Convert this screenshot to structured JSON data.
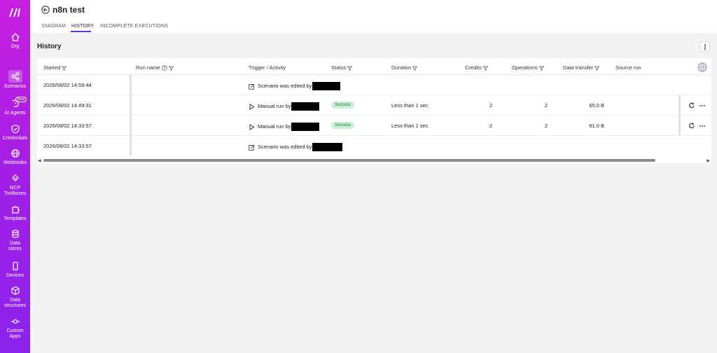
{
  "sidebar": {
    "items": [
      {
        "label": "Org",
        "icon": "home-icon"
      },
      {
        "label": "Scenarios",
        "icon": "share-icon",
        "active": true
      },
      {
        "label": "AI Agents",
        "icon": "ai-agent-icon",
        "badge": "Beta"
      },
      {
        "label": "Credentials",
        "icon": "shield-check-icon"
      },
      {
        "label": "Webhooks",
        "icon": "globe-icon"
      },
      {
        "label": "MCP Toolboxes",
        "icon": "mcp-icon"
      },
      {
        "label": "Templates",
        "icon": "puzzle-icon"
      },
      {
        "label": "Data stores",
        "icon": "database-icon"
      },
      {
        "label": "Devices",
        "icon": "phone-icon"
      },
      {
        "label": "Data structures",
        "icon": "cube-icon"
      },
      {
        "label": "Custom Apps",
        "icon": "custom-app-icon"
      }
    ]
  },
  "header": {
    "title": "n8n test",
    "tabs": [
      {
        "label": "DIAGRAM"
      },
      {
        "label": "HISTORY",
        "active": true
      },
      {
        "label": "INCOMPLETE EXECUTIONS"
      }
    ]
  },
  "main": {
    "section_title": "History",
    "columns": [
      "Started",
      "Run name",
      "Trigger / Activity",
      "Status",
      "Duration",
      "Credits",
      "Operations",
      "Data transfer",
      "Source run"
    ],
    "rows": [
      {
        "started": "2026/08/02 14:59:44",
        "trigger": "Scenario was edited by",
        "trigger_type": "edit"
      },
      {
        "started": "2026/08/02 14:49:31",
        "trigger": "Manual run by",
        "trigger_type": "run",
        "status": "Success",
        "duration": "Less than 1 sec",
        "credits": "2",
        "operations": "2",
        "data_transfer": "65.0 B"
      },
      {
        "started": "2026/08/02 14:33:57",
        "trigger": "Manual run by",
        "trigger_type": "run",
        "status": "Success",
        "duration": "Less than 1 sec",
        "credits": "2",
        "operations": "2",
        "data_transfer": "61.0 B"
      },
      {
        "started": "2026/08/02 14:33:57",
        "trigger": "Scenario was edited by",
        "trigger_type": "edit"
      }
    ]
  },
  "colors": {
    "accent": "#6d28d9",
    "sidebar_top": "#c81fe0",
    "sidebar_bottom": "#8b22ec",
    "success_bg": "#c9efd4",
    "success_text": "#1f7a3a"
  }
}
